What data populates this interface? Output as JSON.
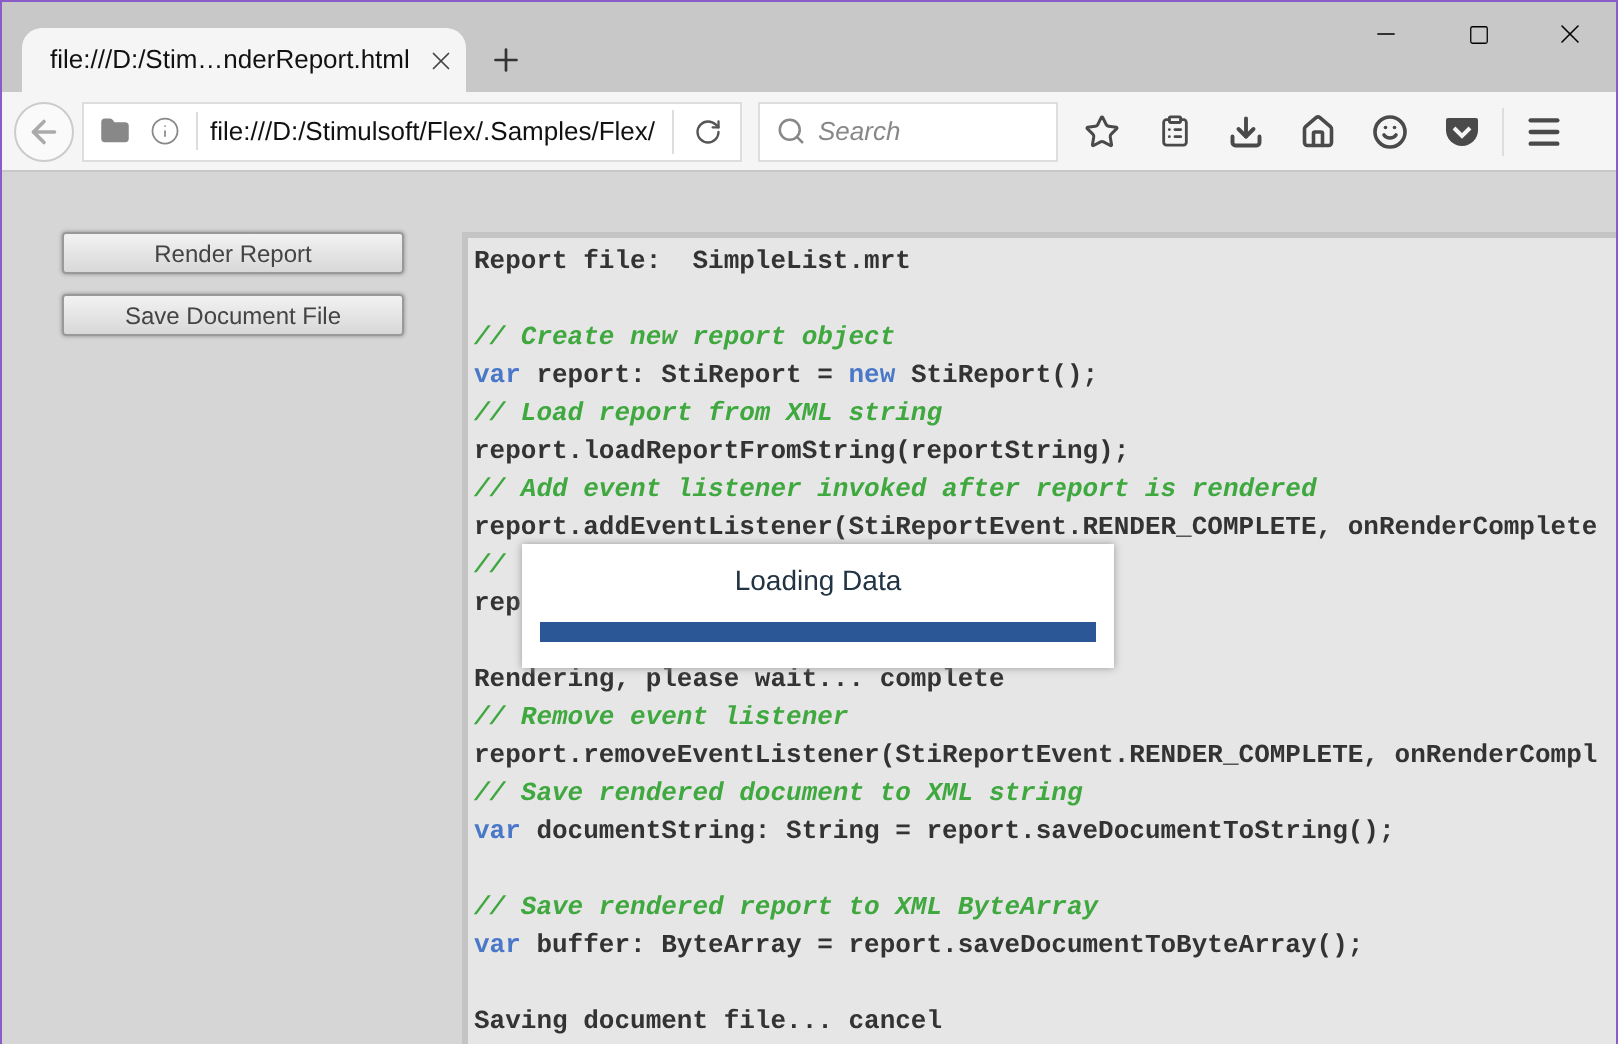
{
  "tab": {
    "title": "file:///D:/Stim…nderReport.html",
    "selected": true
  },
  "address": {
    "url": "file:///D:/Stimulsoft/Flex/.Samples/Flex/"
  },
  "search": {
    "placeholder": "Search"
  },
  "buttons": [
    "Render Report",
    "Save Document File"
  ],
  "code_lines": [
    {
      "kind": "plain",
      "text": "Report file:  SimpleList.mrt"
    },
    {
      "kind": "blank"
    },
    {
      "kind": "comment",
      "text": "// Create new report object"
    },
    {
      "kind": "code",
      "segments": [
        {
          "kind": "keyword",
          "text": "var"
        },
        {
          "kind": "plain",
          "text": " report: StiReport = "
        },
        {
          "kind": "keyword",
          "text": "new"
        },
        {
          "kind": "plain",
          "text": " StiReport();"
        }
      ]
    },
    {
      "kind": "comment",
      "text": "// Load report from XML string"
    },
    {
      "kind": "plain",
      "text": "report.loadReportFromString(reportString);"
    },
    {
      "kind": "comment",
      "text": "// Add event listener invoked after report is rendered"
    },
    {
      "kind": "plain",
      "text": "report.addEventListener(StiReportEvent.RENDER_COMPLETE, onRenderComplete"
    },
    {
      "kind": "comment",
      "text": "//"
    },
    {
      "kind": "plain",
      "text": "rep"
    },
    {
      "kind": "blank"
    },
    {
      "kind": "plain",
      "text": "Rendering, please wait... complete"
    },
    {
      "kind": "comment",
      "text": "// Remove event listener"
    },
    {
      "kind": "plain",
      "text": "report.removeEventListener(StiReportEvent.RENDER_COMPLETE, onRenderCompl"
    },
    {
      "kind": "comment",
      "text": "// Save rendered document to XML string"
    },
    {
      "kind": "code",
      "segments": [
        {
          "kind": "keyword",
          "text": "var"
        },
        {
          "kind": "plain",
          "text": " documentString: String = report.saveDocumentToString();"
        }
      ]
    },
    {
      "kind": "blank"
    },
    {
      "kind": "comment",
      "text": "// Save rendered report to XML ByteArray"
    },
    {
      "kind": "code",
      "segments": [
        {
          "kind": "keyword",
          "text": "var"
        },
        {
          "kind": "plain",
          "text": " buffer: ByteArray = report.saveDocumentToByteArray();"
        }
      ]
    },
    {
      "kind": "blank"
    },
    {
      "kind": "plain",
      "text": "Saving document file... cancel"
    }
  ],
  "dialog": {
    "title": "Loading Data",
    "level": 1
  }
}
